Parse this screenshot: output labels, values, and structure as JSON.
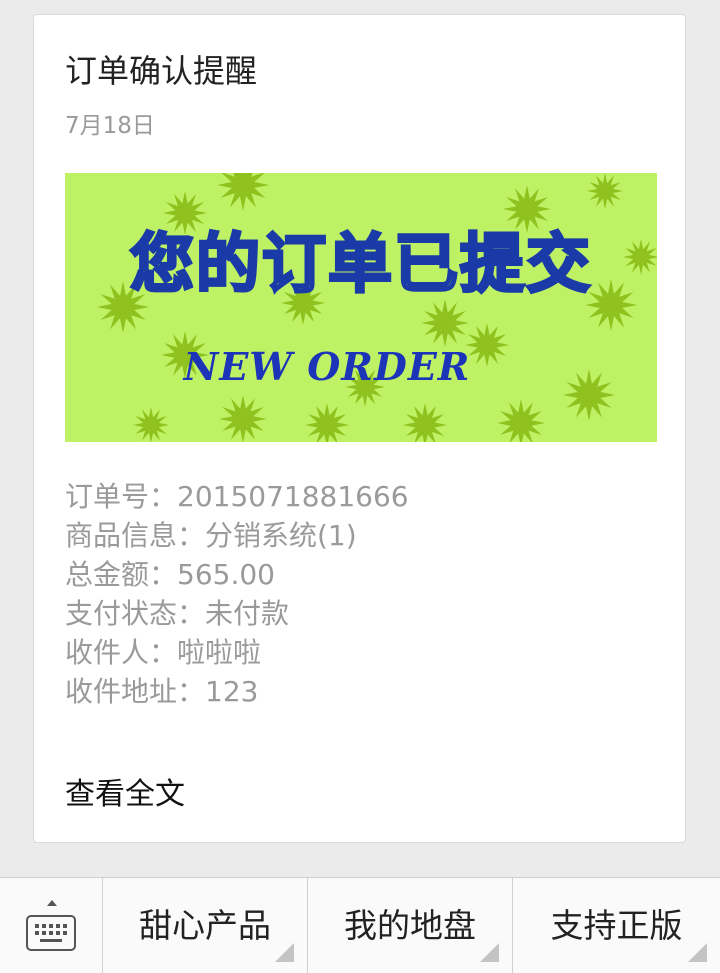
{
  "message": {
    "title": "订单确认提醒",
    "date": "7月18日",
    "banner": {
      "headline": "您的订单已提交",
      "subline": "NEW ORDER",
      "background_color": "#bff165",
      "star_color": "#8fc21f"
    },
    "details": [
      "订单号：2015071881666",
      "商品信息：分销系统(1)",
      "总金额：565.00",
      "支付状态：未付款",
      "收件人：啦啦啦",
      "收件地址：123"
    ],
    "read_more_label": "查看全文"
  },
  "menu": {
    "keyboard_icon": "keyboard-icon",
    "items": [
      {
        "label": "甜心产品"
      },
      {
        "label": "我的地盘"
      },
      {
        "label": "支持正版"
      }
    ]
  }
}
